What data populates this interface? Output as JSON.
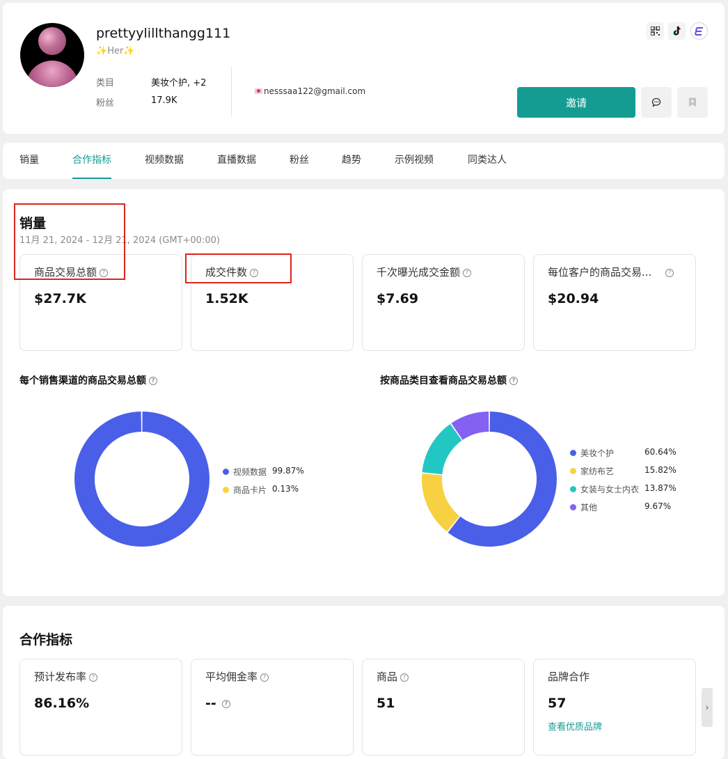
{
  "profile": {
    "username": "prettyylillthangg111",
    "bio": "Her",
    "category_label": "类目",
    "category_value": "美妆个护, +2",
    "followers_label": "粉丝",
    "followers_value": "17.9K",
    "email": "nesssaa122@gmail.com",
    "invite_label": "邀请",
    "top_icons": [
      "qr-code-icon",
      "tiktok-icon",
      "e-brand-icon"
    ],
    "action_icons": [
      "chat-icon",
      "bookmark-icon"
    ]
  },
  "tabs": [
    {
      "label": "销量",
      "active": false
    },
    {
      "label": "合作指标",
      "active": true
    },
    {
      "label": "视频数据",
      "active": false
    },
    {
      "label": "直播数据",
      "active": false
    },
    {
      "label": "粉丝",
      "active": false
    },
    {
      "label": "趋势",
      "active": false
    },
    {
      "label": "示例视频",
      "active": false
    },
    {
      "label": "同类达人",
      "active": false
    }
  ],
  "sales": {
    "title": "销量",
    "date_range": "11月 21, 2024 - 12月 21, 2024 (GMT+00:00)",
    "metrics": [
      {
        "label": "商品交易总额",
        "value": "$27.7K"
      },
      {
        "label": "成交件数",
        "value": "1.52K"
      },
      {
        "label": "千次曝光成交金额",
        "value": "$7.69"
      },
      {
        "label": "每位客户的商品交易...",
        "value": "$20.94"
      }
    ],
    "help_glyph": "?"
  },
  "chart_data": [
    {
      "type": "pie",
      "title": "每个销售渠道的商品交易总额",
      "categories": [
        "视频数据",
        "商品卡片"
      ],
      "values": [
        99.87,
        0.13
      ],
      "labels": [
        "99.87%",
        "0.13%"
      ],
      "colors": [
        "#4a5fe8",
        "#f8d142"
      ],
      "legend": "right"
    },
    {
      "type": "pie",
      "title": "按商品类目查看商品交易总额",
      "categories": [
        "美妆个护",
        "家纺布艺",
        "女装与女士内衣",
        "其他"
      ],
      "values": [
        60.64,
        15.82,
        13.87,
        9.67
      ],
      "labels": [
        "60.64%",
        "15.82%",
        "13.87%",
        "9.67%"
      ],
      "colors": [
        "#4a5fe8",
        "#f8d142",
        "#22c7c3",
        "#8461f2"
      ],
      "legend": "right"
    }
  ],
  "cooperation": {
    "title": "合作指标",
    "metrics": [
      {
        "label": "预计发布率",
        "value": "86.16%"
      },
      {
        "label": "平均佣金率",
        "value": "--"
      },
      {
        "label": "商品",
        "value": "51"
      },
      {
        "label": "品牌合作",
        "value": "57",
        "link": "查看优质品牌"
      }
    ],
    "next_arrow": "›"
  },
  "colors": {
    "accent": "#149c93",
    "highlight": "#d9261c",
    "page_bg": "#f0f0f1"
  }
}
